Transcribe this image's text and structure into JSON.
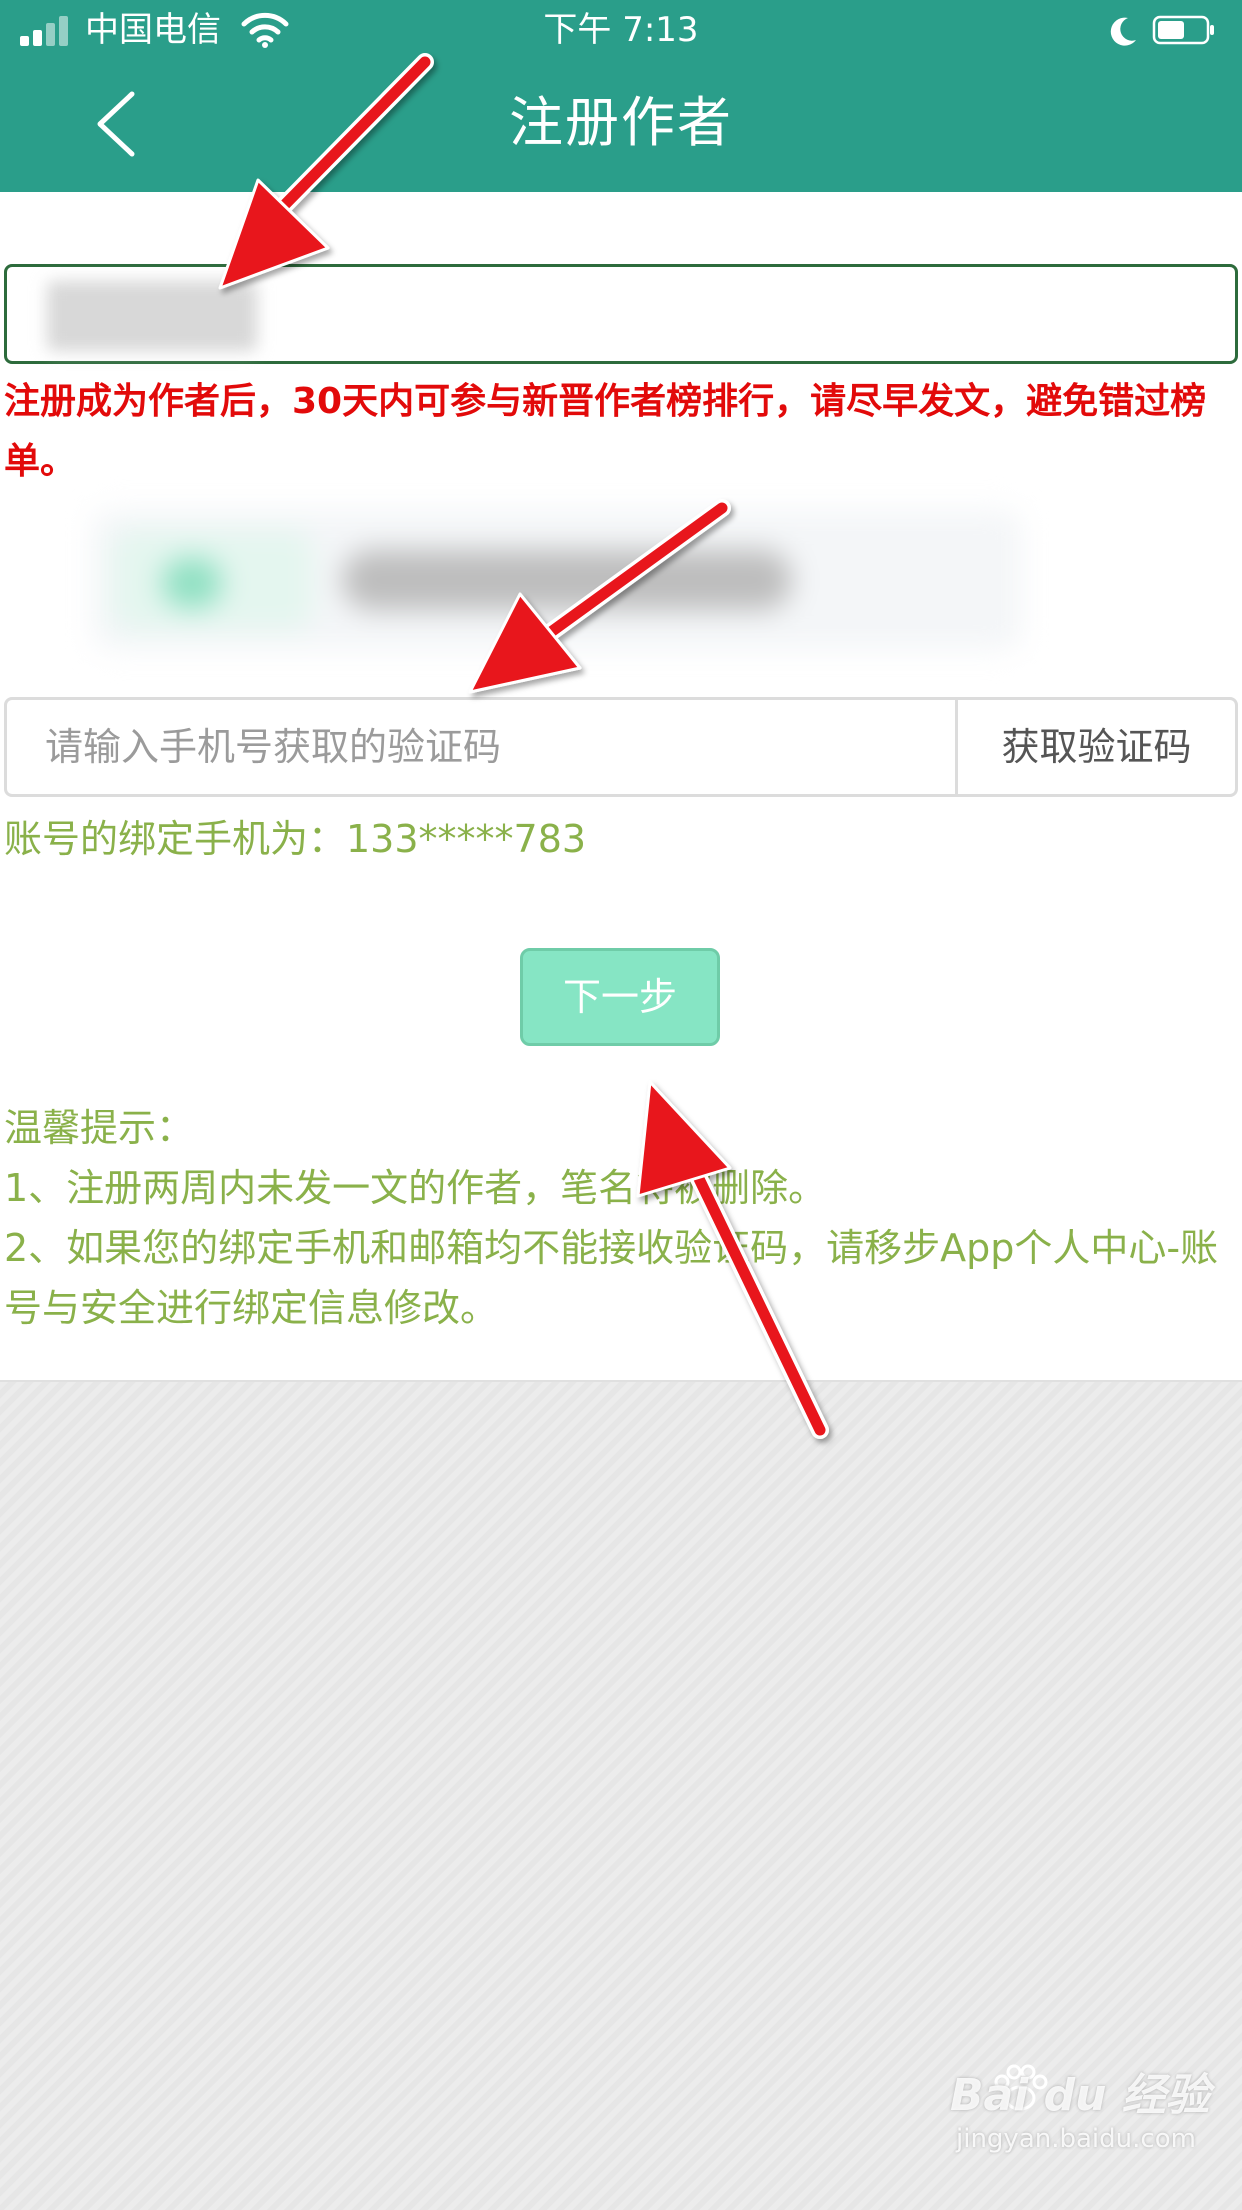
{
  "status_bar": {
    "carrier": "中国电信",
    "time": "下午 7:13"
  },
  "nav": {
    "title": "注册作者",
    "back_icon": "chevron-left-icon"
  },
  "form": {
    "name_value": "",
    "notice": "注册成为作者后，30天内可参与新晋作者榜排行，请尽早发文，避免错过榜单。",
    "code_placeholder": "请输入手机号获取的验证码",
    "get_code_label": "获取验证码",
    "bound_phone": "账号的绑定手机为：133*****783",
    "next_label": "下一步"
  },
  "tips": {
    "heading": "温馨提示：",
    "items": [
      "1、注册两周内未发一文的作者，笔名将被删除。",
      "2、如果您的绑定手机和邮箱均不能接收验证码，请移步App个人中心-账号与安全进行绑定信息修改。"
    ]
  },
  "watermark": {
    "brand": "Bai du 经验",
    "site": "jingyan.baidu.com"
  },
  "colors": {
    "header": "#2a9e8a",
    "notice_red": "#e20a0a",
    "tip_green": "#8ab14a",
    "button_green": "#86e5c4",
    "arrow_red": "#e8141a"
  }
}
